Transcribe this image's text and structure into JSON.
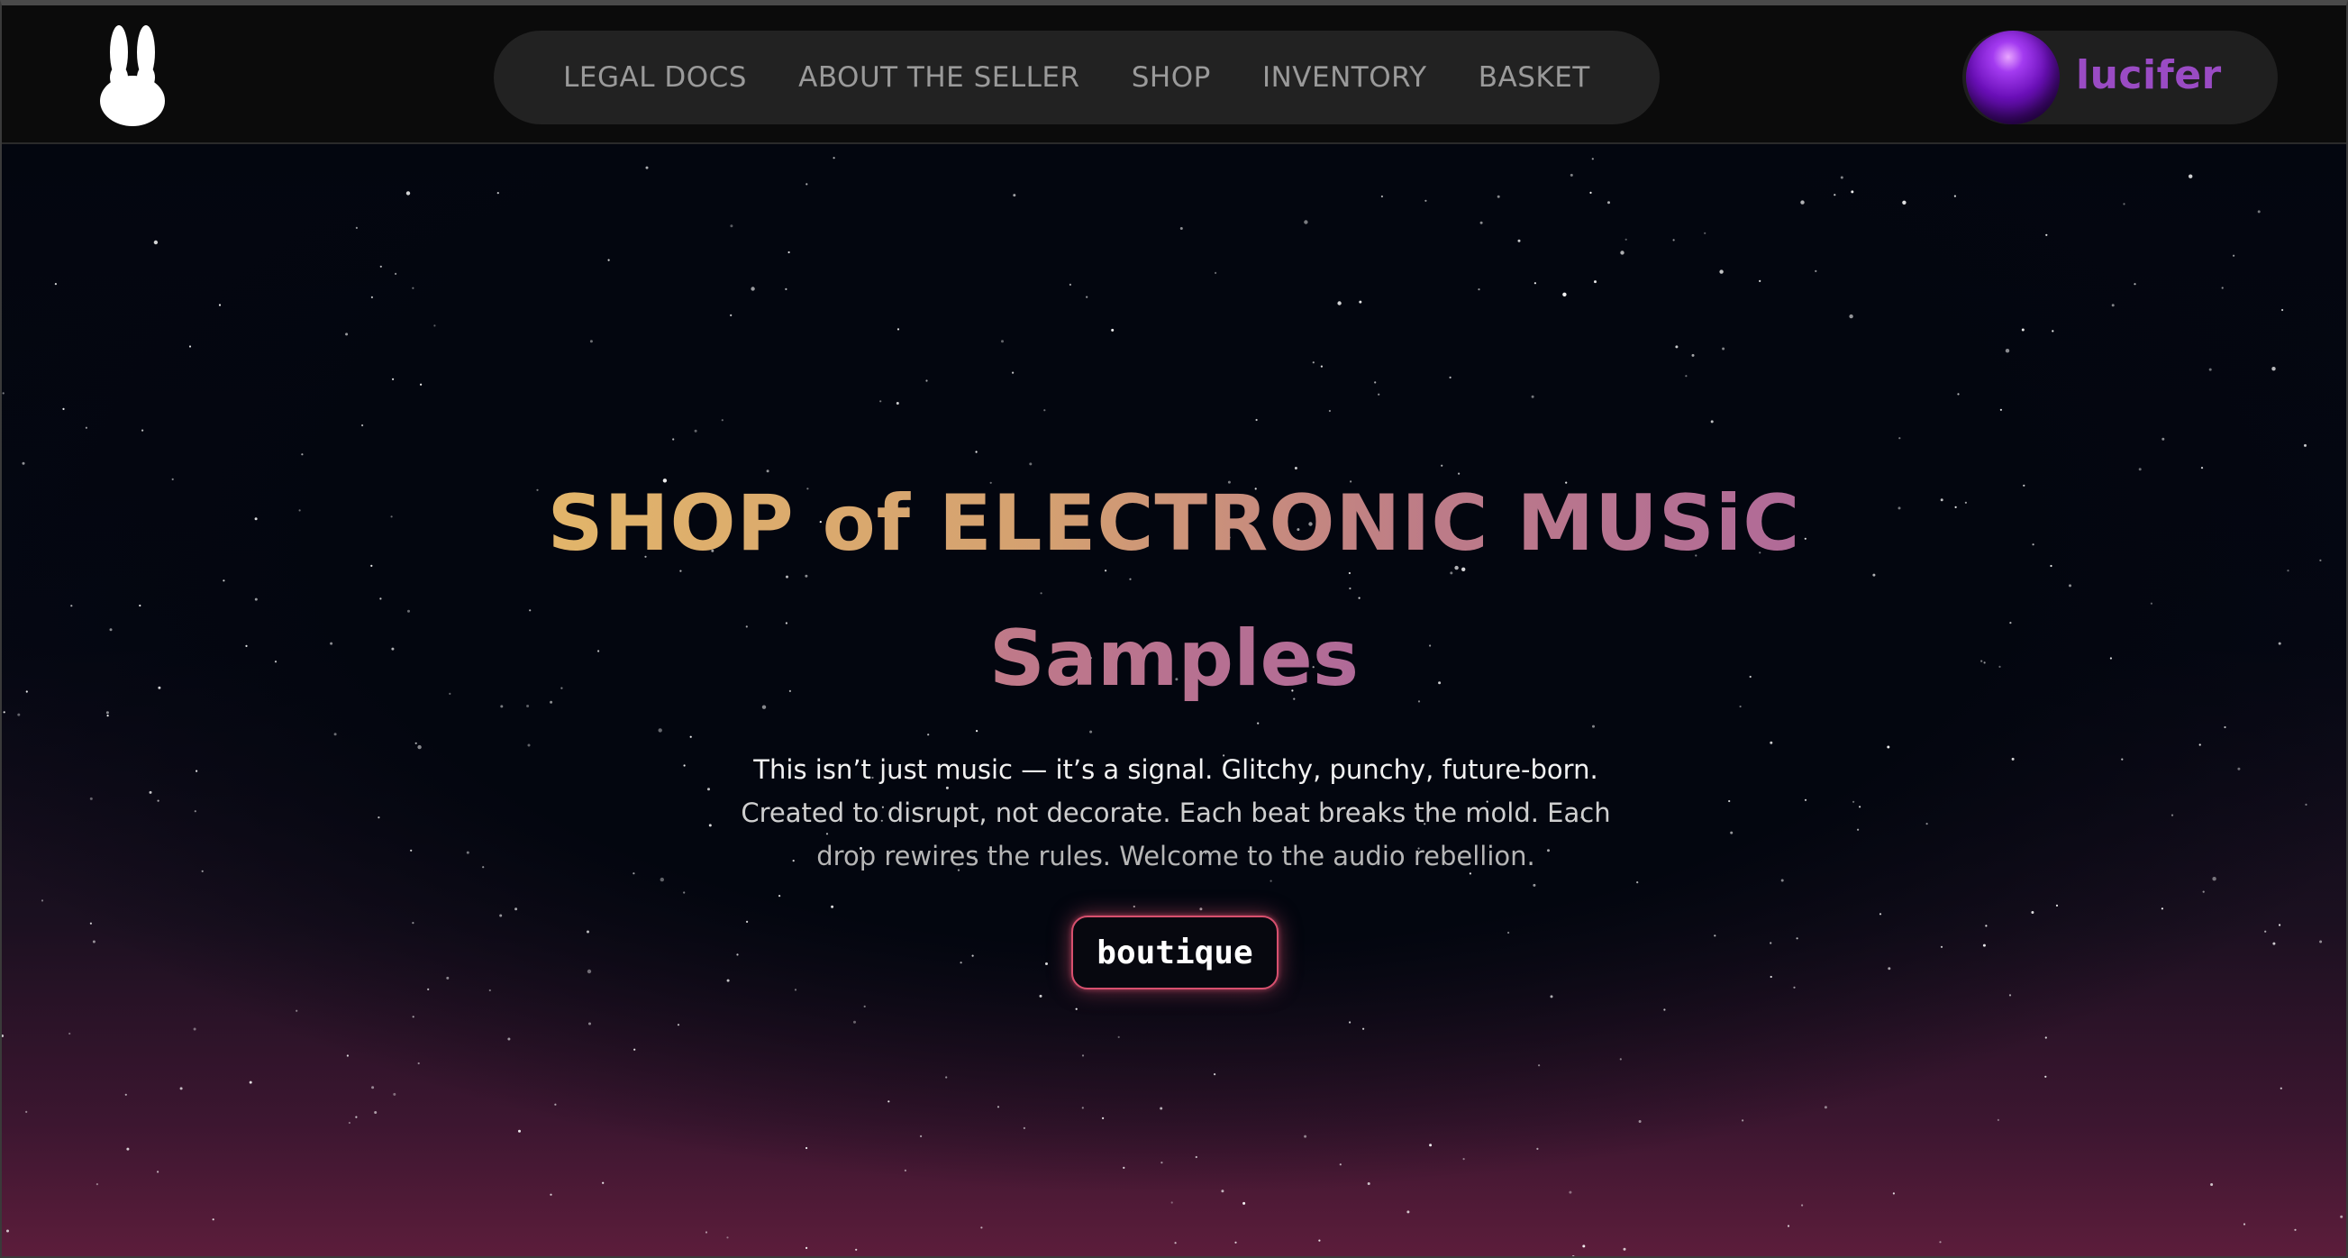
{
  "nav": {
    "items": [
      {
        "label": "LEGAL DOCS",
        "name": "nav-legal-docs"
      },
      {
        "label": "ABOUT THE SELLER",
        "name": "nav-about-seller"
      },
      {
        "label": "SHOP",
        "name": "nav-shop"
      },
      {
        "label": "INVENTORY",
        "name": "nav-inventory"
      },
      {
        "label": "BASKET",
        "name": "nav-basket"
      }
    ]
  },
  "user": {
    "name": "lucifer",
    "avatar_icon": "purple-orb-avatar"
  },
  "hero": {
    "title_line1": "SHOP of ELECTRONIC MUSiC",
    "title_line2": "Samples",
    "description": {
      "line1": "This isn’t just music — it’s a signal. Glitchy, punchy, future-born.",
      "line2": "Created to disrupt, not decorate. Each beat breaks the mold. Each",
      "line3": "drop rewires the rules. Welcome to the audio rebellion."
    },
    "cta_label": "boutique"
  },
  "colors": {
    "title_gold": "#e2b56a",
    "title_pink": "#b06a98",
    "cta_border": "#d7506e",
    "username": "#9a4bc4"
  },
  "icons": {
    "logo": "rabbit-icon"
  }
}
